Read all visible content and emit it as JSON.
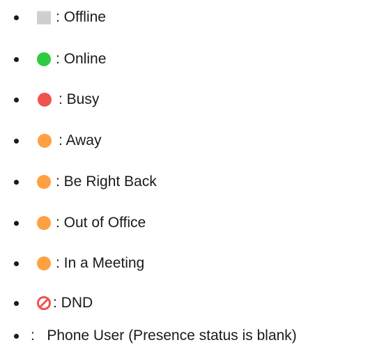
{
  "colors": {
    "offline": "#c8c8c8",
    "online": "#2ecc40",
    "busy": "#ef5350",
    "away": "#ffa040",
    "dnd": "#ef5350",
    "text": "#1a1a1a"
  },
  "statuses": [
    {
      "icon": "offline-square-icon",
      "label": ": Offline"
    },
    {
      "icon": "online-dot-icon",
      "label": ": Online"
    },
    {
      "icon": "busy-dot-icon",
      "label": ": Busy"
    },
    {
      "icon": "away-dot-icon",
      "label": ": Away"
    },
    {
      "icon": "away-dot-icon",
      "label": ": Be Right Back"
    },
    {
      "icon": "away-dot-icon",
      "label": ": Out of Office"
    },
    {
      "icon": "away-dot-icon",
      "label": ": In a Meeting"
    },
    {
      "icon": "dnd-prohibited-icon",
      "label": ": DND"
    },
    {
      "icon": "",
      "label": ":   Phone User (Presence status is blank)"
    }
  ]
}
